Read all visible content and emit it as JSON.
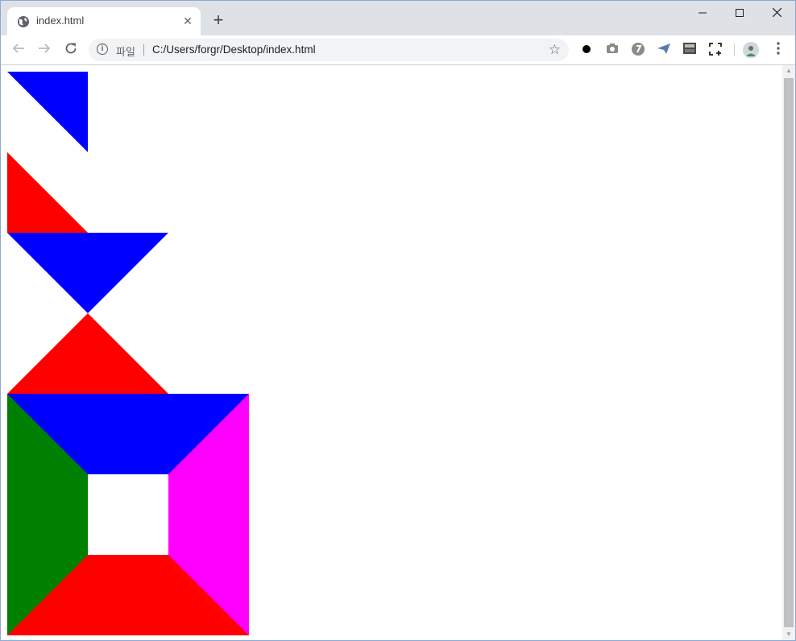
{
  "browser": {
    "tab": {
      "title": "index.html",
      "close_glyph": "✕"
    },
    "new_tab_glyph": "+",
    "window_controls": {
      "minimize": "—",
      "maximize": "☐",
      "close": "✕"
    },
    "omnibox": {
      "scheme_label": "파일",
      "url": "C:/Users/forgr/Desktop/index.html"
    },
    "icons": {
      "back": "back-arrow-icon",
      "forward": "forward-arrow-icon",
      "reload": "reload-icon",
      "info": "info-icon",
      "bookmark": "star-icon",
      "menu": "three-dot-menu-icon"
    }
  },
  "page": {
    "colors": {
      "blue": "#0000ff",
      "red": "#ff0000",
      "green": "#008000",
      "magenta": "#ff00ff",
      "background": "#ffffff"
    }
  }
}
